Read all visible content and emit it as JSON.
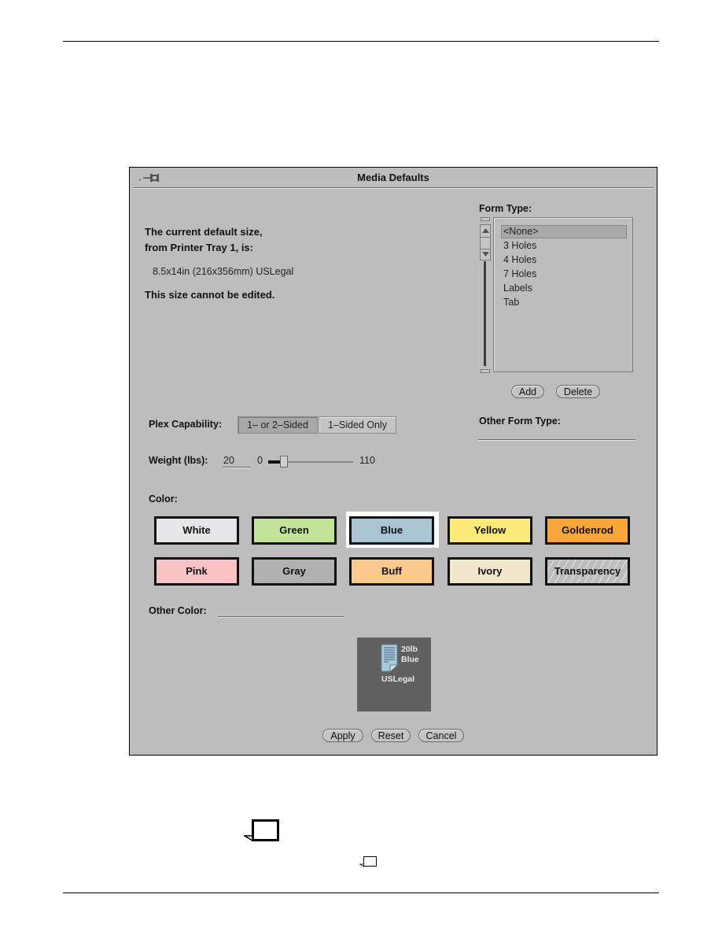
{
  "window": {
    "title": "Media Defaults",
    "pin_icon": "pushpin-icon"
  },
  "info": {
    "line1": "The current default size,",
    "line2": "from Printer Tray 1, is:",
    "size": "8.5x14in (216x356mm) USLegal",
    "note": "This size cannot be edited."
  },
  "form_type": {
    "label": "Form Type:",
    "selected": "<None>",
    "items": [
      "<None>",
      "3 Holes",
      "4 Holes",
      "7 Holes",
      "Labels",
      "Tab"
    ],
    "add_label": "Add",
    "delete_label": "Delete",
    "other_label": "Other Form Type:",
    "other_value": ""
  },
  "plex": {
    "label": "Plex Capability:",
    "options": [
      "1– or 2–Sided",
      "1–Sided Only"
    ],
    "selected": "1– or 2–Sided"
  },
  "weight": {
    "label": "Weight (lbs):",
    "value": "20",
    "min": "0",
    "max": "110",
    "slider_value": 20
  },
  "color": {
    "label": "Color:",
    "selected": "Blue",
    "swatches": [
      {
        "name": "White",
        "hex": "#e6e6ea"
      },
      {
        "name": "Green",
        "hex": "#c3e39b"
      },
      {
        "name": "Blue",
        "hex": "#a9c4d3"
      },
      {
        "name": "Yellow",
        "hex": "#fbe97a"
      },
      {
        "name": "Goldenrod",
        "hex": "#f7a73a"
      },
      {
        "name": "Pink",
        "hex": "#f9c3c6"
      },
      {
        "name": "Gray",
        "hex": "#b1b1b1"
      },
      {
        "name": "Buff",
        "hex": "#fac98b"
      },
      {
        "name": "Ivory",
        "hex": "#efe6cc"
      },
      {
        "name": "Transparency",
        "hex": "#bdbdbd"
      }
    ],
    "other_label": "Other Color:",
    "other_value": ""
  },
  "preview": {
    "weight_text": "20lb",
    "color_text": "Blue",
    "size_text": "USLegal",
    "icon": "paper-sheet-icon"
  },
  "actions": {
    "apply": "Apply",
    "reset": "Reset",
    "cancel": "Cancel"
  }
}
